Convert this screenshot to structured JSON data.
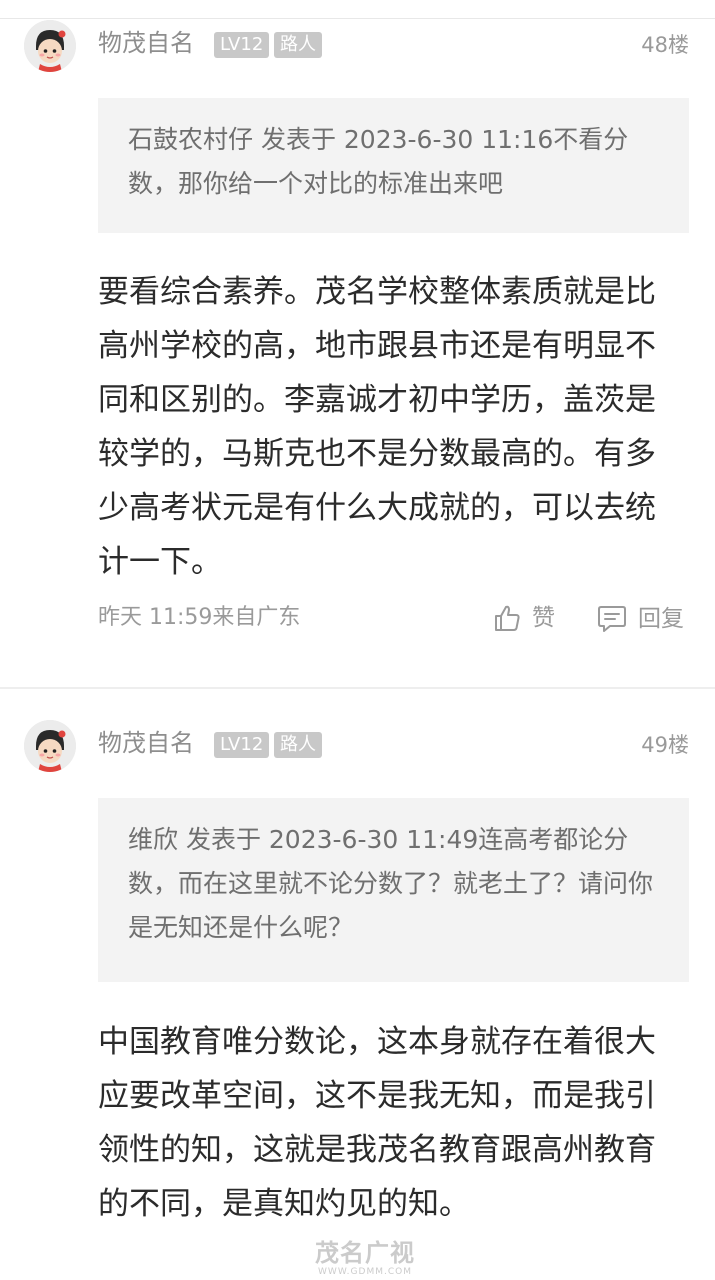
{
  "posts": [
    {
      "author": "物茂自名",
      "level": "LV12",
      "role": "路人",
      "floor": "48楼",
      "quote": "石鼓农村仔 发表于 2023-6-30 11:16不看分数，那你给一个对比的标准出来吧",
      "body": "要看综合素养。茂名学校整体素质就是比高州学校的高，地市跟县市还是有明显不同和区别的。李嘉诚才初中学历，盖茨是较学的，马斯克也不是分数最高的。有多少高考状元是有什么大成就的，可以去统计一下。",
      "time_location": "昨天 11:59来自广东",
      "like_label": "赞",
      "reply_label": "回复"
    },
    {
      "author": "物茂自名",
      "level": "LV12",
      "role": "路人",
      "floor": "49楼",
      "quote": "维欣 发表于 2023-6-30 11:49连高考都论分数，而在这里就不论分数了？就老土了？请问你是无知还是什么呢？",
      "body": "中国教育唯分数论，这本身就存在着很大应要改革空间，这不是我无知，而是我引领性的知，这就是我茂名教育跟高州教育的不同，是真知灼见的知。"
    }
  ],
  "watermark": {
    "text": "茂名广视",
    "url": "WWW.GDMM.COM"
  },
  "icons": {
    "avatar": "cartoon-girl-avatar",
    "like": "thumbs-up-icon",
    "reply": "comment-icon"
  }
}
